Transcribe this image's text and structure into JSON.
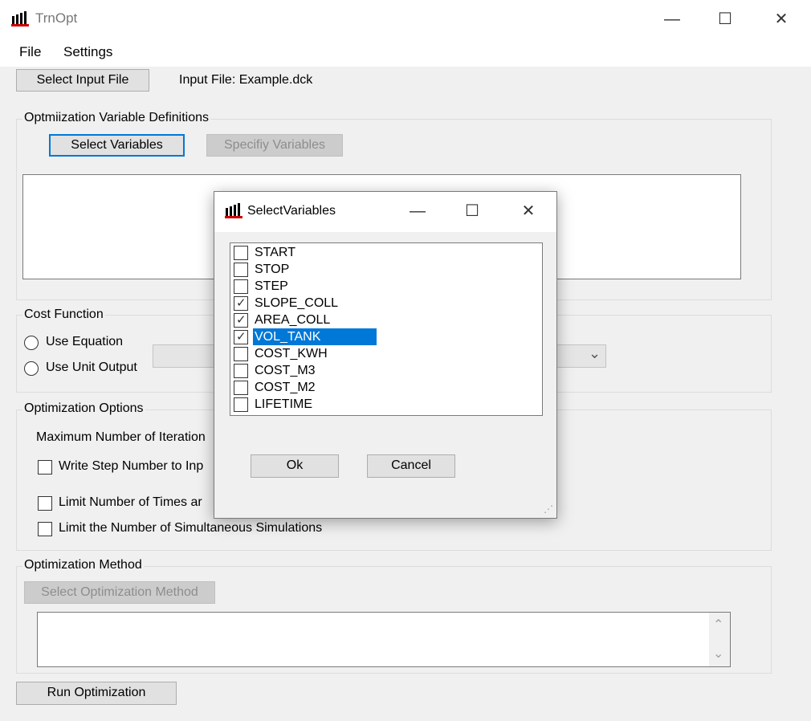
{
  "window": {
    "title": "TrnOpt",
    "minimize_glyph": "—",
    "maximize_glyph": "☐",
    "close_glyph": "✕"
  },
  "menu": {
    "items": [
      "File",
      "Settings"
    ]
  },
  "input_file": {
    "select_button": "Select Input File",
    "label": "Input File: Example.dck"
  },
  "variables_group": {
    "title": "Optmiization Variable Definitions",
    "select_button": "Select Variables",
    "specify_button": "Specifiy Variables"
  },
  "cost_group": {
    "title": "Cost Function",
    "option_equation": "Use Equation",
    "option_unit_output": "Use Unit Output"
  },
  "options_group": {
    "title": "Optimization Options",
    "max_iterations": "Maximum Number of Iteration",
    "write_step": "Write Step Number to Inp",
    "limit_times": "Limit Number of Times ar",
    "limit_simultaneous": "Limit the Number of Simultaneous Simulations"
  },
  "method_group": {
    "title": "Optimization Method",
    "select_button": "Select Optimization Method"
  },
  "run_button": "Run Optimization",
  "dialog": {
    "title": "SelectVariables",
    "ok": "Ok",
    "cancel": "Cancel",
    "items": [
      {
        "label": "START",
        "checked": false,
        "selected": false
      },
      {
        "label": "STOP",
        "checked": false,
        "selected": false
      },
      {
        "label": "STEP",
        "checked": false,
        "selected": false
      },
      {
        "label": "SLOPE_COLL",
        "checked": true,
        "selected": false
      },
      {
        "label": "AREA_COLL",
        "checked": true,
        "selected": false
      },
      {
        "label": "VOL_TANK",
        "checked": true,
        "selected": true
      },
      {
        "label": "COST_KWH",
        "checked": false,
        "selected": false
      },
      {
        "label": "COST_M3",
        "checked": false,
        "selected": false
      },
      {
        "label": "COST_M2",
        "checked": false,
        "selected": false
      },
      {
        "label": "LIFETIME",
        "checked": false,
        "selected": false
      }
    ]
  },
  "icons": {
    "app": "app-logo-icon",
    "check": "✓",
    "chevron_down": "⌄",
    "scroll_up": "⌃",
    "scroll_down": "⌄",
    "resize_grip": "⋰"
  }
}
